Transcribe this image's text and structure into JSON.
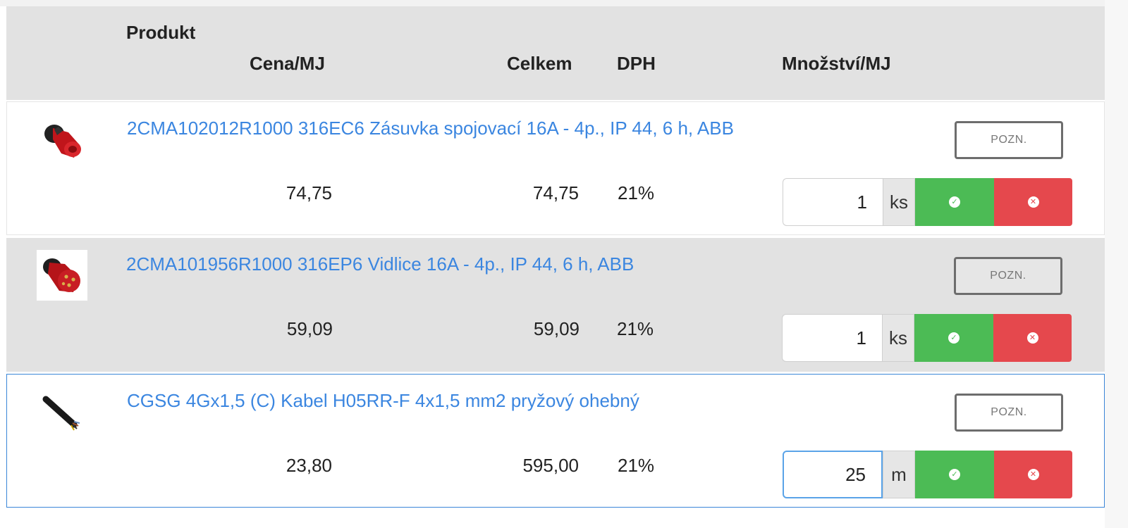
{
  "header": {
    "product": "Produkt",
    "price_per_unit": "Cena/MJ",
    "total": "Celkem",
    "vat": "DPH",
    "quantity_per_unit": "Množství/MJ"
  },
  "items": [
    {
      "name": "2CMA102012R1000 316EC6 Zásuvka spojovací 16A - 4p., IP 44, 6 h, ABB",
      "price": "74,75",
      "total": "74,75",
      "vat": "21%",
      "quantity": "1",
      "unit": "ks",
      "note_label": "POZN.",
      "image": "red-socket-icon"
    },
    {
      "name": "2CMA101956R1000 316EP6 Vidlice 16A - 4p., IP 44, 6 h, ABB",
      "price": "59,09",
      "total": "59,09",
      "vat": "21%",
      "quantity": "1",
      "unit": "ks",
      "note_label": "POZN.",
      "image": "red-plug-icon"
    },
    {
      "name": "CGSG 4Gx1,5 (C) Kabel H05RR-F 4x1,5 mm2 pryžový ohebný",
      "price": "23,80",
      "total": "595,00",
      "vat": "21%",
      "quantity": "25",
      "unit": "m",
      "note_label": "POZN.",
      "image": "cable-icon"
    }
  ],
  "colors": {
    "link": "#3b86e0",
    "confirm": "#4cbb55",
    "remove": "#e5484d",
    "header_bg": "#e2e2e2",
    "focus_border": "#3a86d8"
  },
  "icons": {
    "confirm": "check-circle-icon",
    "remove": "times-circle-icon"
  }
}
